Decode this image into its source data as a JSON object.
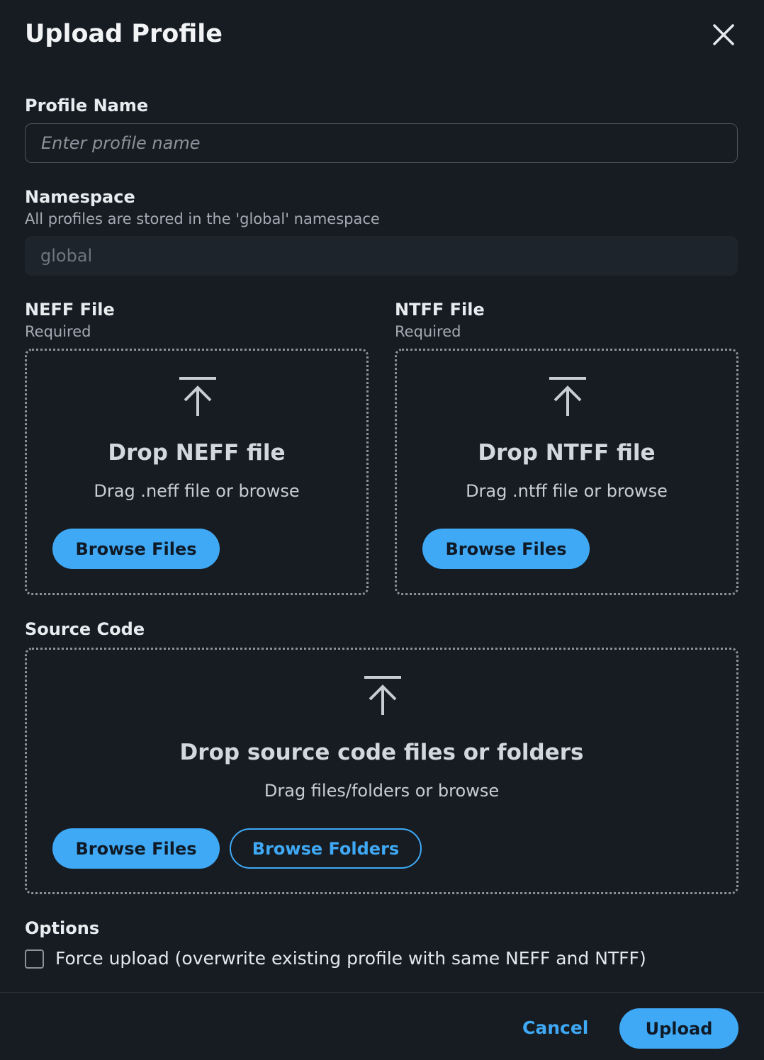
{
  "dialog": {
    "title": "Upload Profile",
    "close_icon": "close-icon"
  },
  "profile_name": {
    "label": "Profile Name",
    "placeholder": "Enter profile name",
    "value": ""
  },
  "namespace": {
    "label": "Namespace",
    "description": "All profiles are stored in the 'global' namespace",
    "value": "global"
  },
  "neff": {
    "label": "NEFF File",
    "required": "Required",
    "icon": "upload-icon",
    "drop_title": "Drop NEFF file",
    "drop_subtitle": "Drag .neff file or browse",
    "browse_files": "Browse Files"
  },
  "ntff": {
    "label": "NTFF File",
    "required": "Required",
    "icon": "upload-icon",
    "drop_title": "Drop NTFF file",
    "drop_subtitle": "Drag .ntff file or browse",
    "browse_files": "Browse Files"
  },
  "source_code": {
    "label": "Source Code",
    "icon": "upload-icon",
    "drop_title": "Drop source code files or folders",
    "drop_subtitle": "Drag files/folders or browse",
    "browse_files": "Browse Files",
    "browse_folders": "Browse Folders"
  },
  "options": {
    "label": "Options",
    "force_upload": {
      "label": "Force upload (overwrite existing profile with same NEFF and NTFF)",
      "checked": false
    }
  },
  "footer": {
    "cancel": "Cancel",
    "upload": "Upload"
  },
  "colors": {
    "background": "#171c23",
    "accent": "#3fa9f5",
    "border": "#4c535c"
  }
}
